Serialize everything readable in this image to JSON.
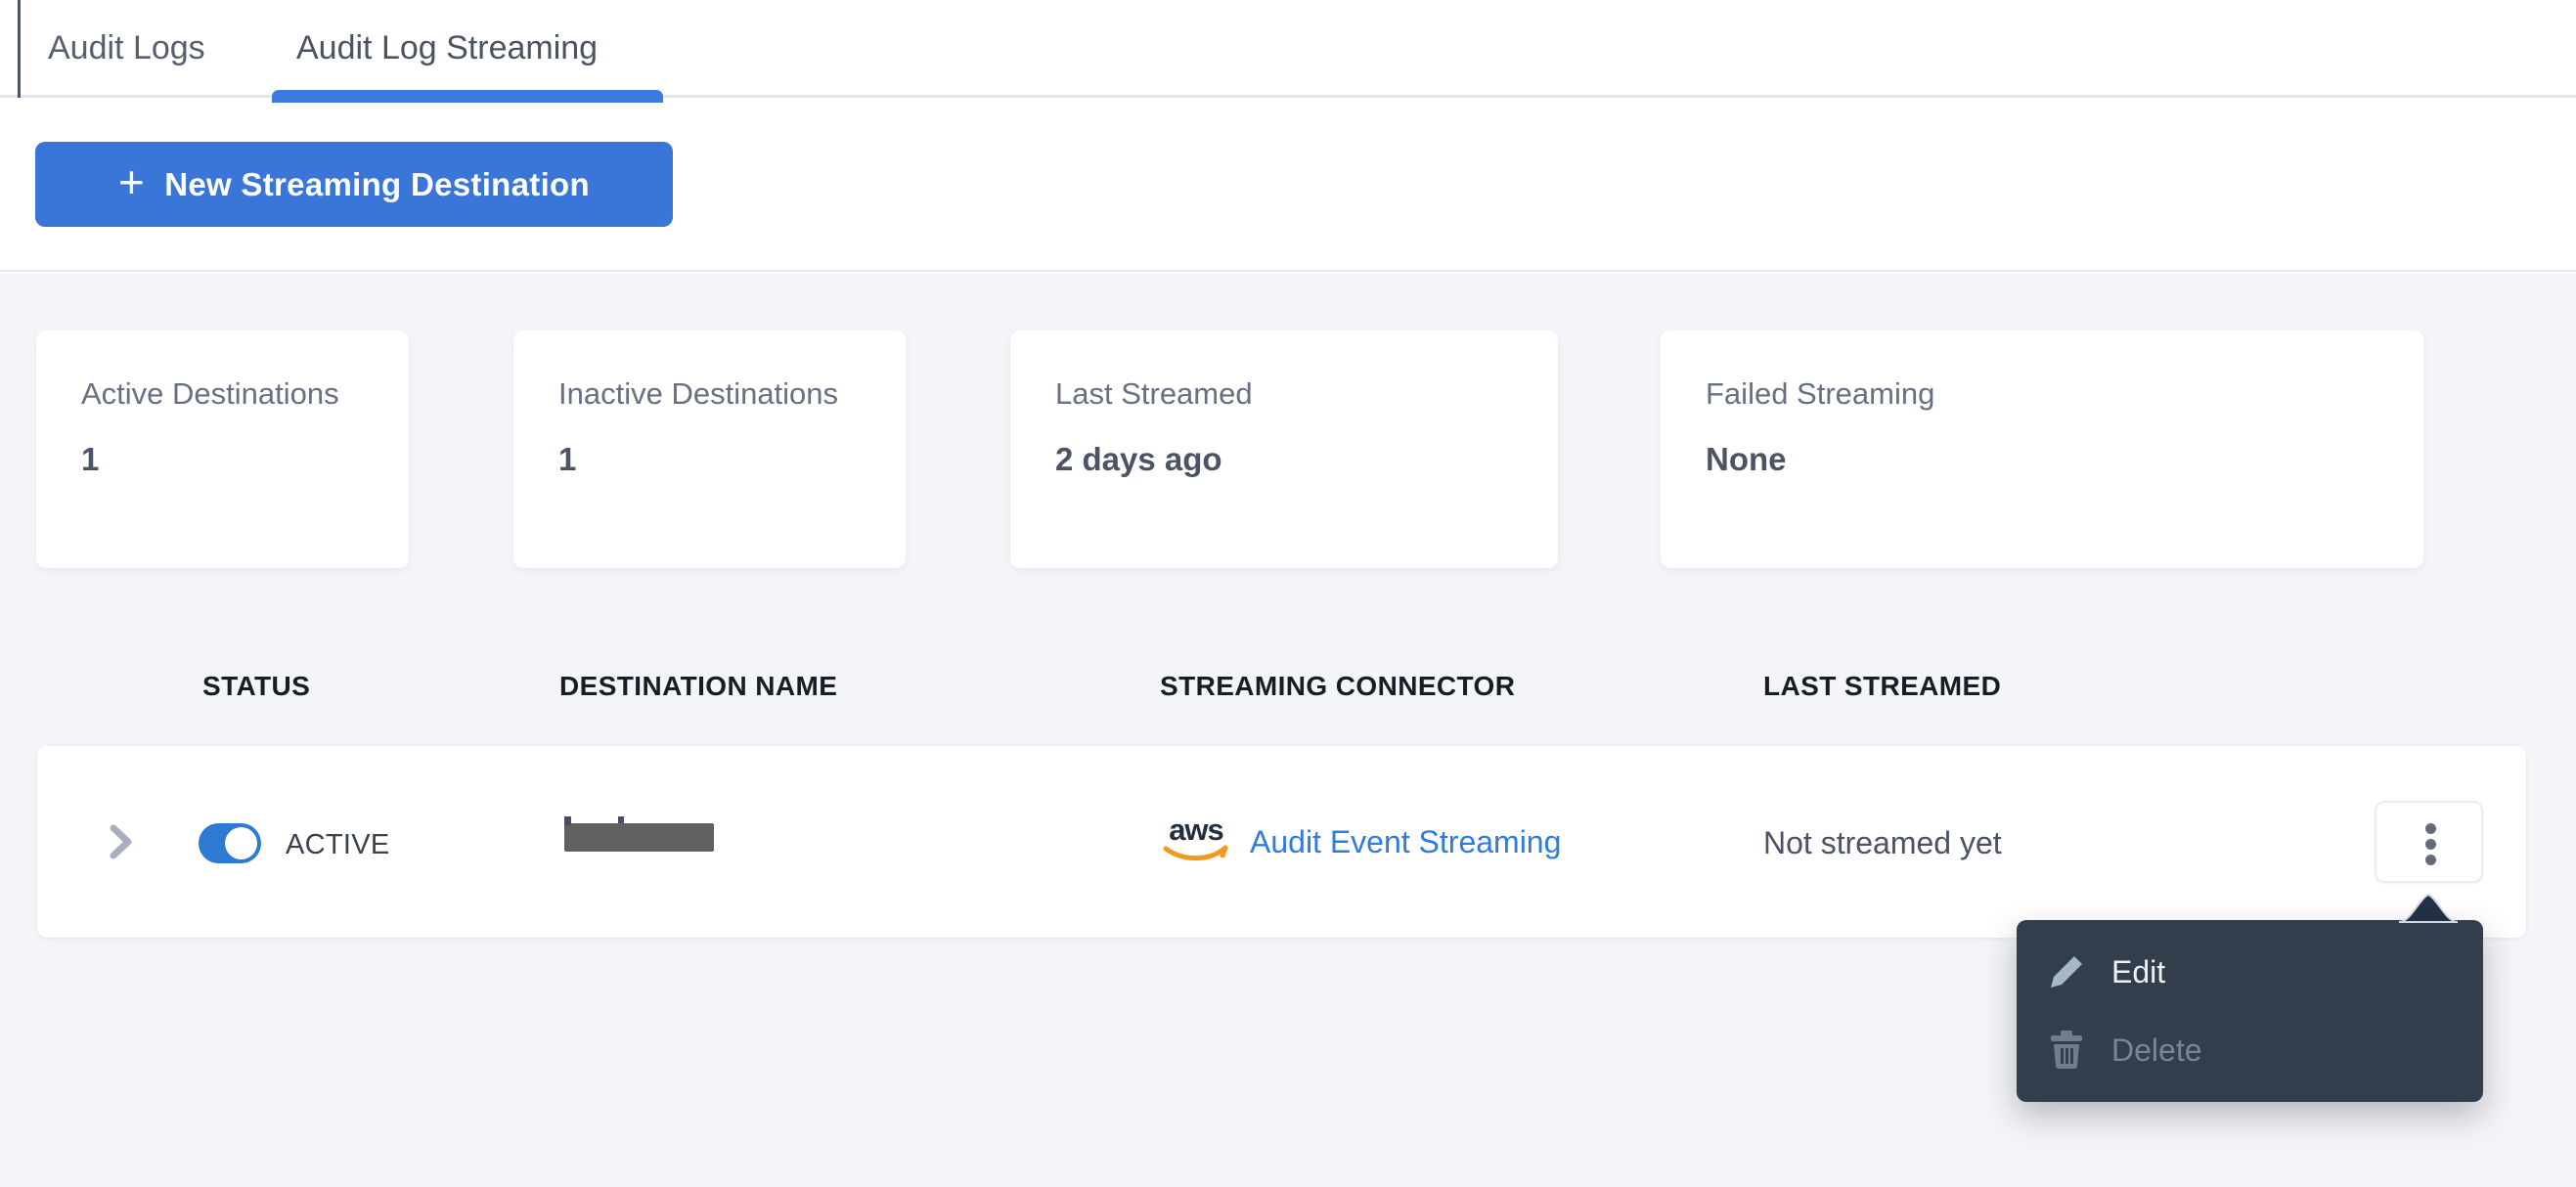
{
  "header": {
    "tabs": [
      {
        "label": "Audit Logs",
        "active": false
      },
      {
        "label": "Audit Log Streaming",
        "active": true
      }
    ]
  },
  "toolbar": {
    "plus_glyph": "+",
    "new_streaming_destination_label": "New Streaming Destination"
  },
  "stats": {
    "cards": [
      {
        "label": "Active Destinations",
        "value": "1"
      },
      {
        "label": "Inactive Destinations",
        "value": "1"
      },
      {
        "label": "Last Streamed",
        "value": "2 days ago"
      },
      {
        "label": "Failed Streaming",
        "value": "None"
      }
    ]
  },
  "table": {
    "headers": [
      "STATUS",
      "DESTINATION NAME",
      "STREAMING CONNECTOR",
      "LAST STREAMED"
    ],
    "row": {
      "status_label": "ACTIVE",
      "toggle_state": "on",
      "destination_name_redacted": true,
      "connector_brand": "aws",
      "connector_label": "Audit Event Streaming",
      "last_streamed": "Not streamed yet"
    }
  },
  "context_menu": {
    "items": [
      {
        "label": "Edit",
        "icon": "pencil-icon",
        "disabled": false
      },
      {
        "label": "Delete",
        "icon": "trash-icon",
        "disabled": true
      }
    ]
  },
  "colors": {
    "accent_blue": "#3A76D8",
    "tab_indicator_blue": "#3B79DE",
    "toggle_blue": "#2E79D2",
    "link_blue": "#2E7CE0",
    "menu_bg": "#333E4D",
    "menu_caret": "#232F45",
    "page_bg": "#F4F5F8",
    "redaction_gray": "#616161",
    "aws_orange": "#F6981E"
  }
}
